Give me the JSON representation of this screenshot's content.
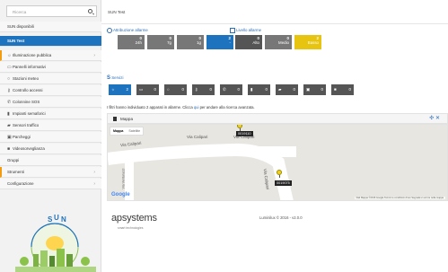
{
  "sidebar": {
    "search_placeholder": "Ricerca",
    "items": [
      {
        "label": "SUN disponibili",
        "icon": "",
        "chevron": false
      },
      {
        "label": "SUN Test",
        "icon": "",
        "chevron": false,
        "active": true
      },
      {
        "label": "Illuminazione pubblica",
        "icon": "lightbulb-icon",
        "chevron": true
      },
      {
        "label": "Pannelli informativi",
        "icon": "monitor-icon",
        "chevron": false
      },
      {
        "label": "Stazioni meteo",
        "icon": "cloud-icon",
        "chevron": false
      },
      {
        "label": "Controllo accessi",
        "icon": "key-icon",
        "chevron": false
      },
      {
        "label": "Colonnine SOS",
        "icon": "phone-icon",
        "chevron": false
      },
      {
        "label": "Impianti semaforici",
        "icon": "traffic-light-icon",
        "chevron": false
      },
      {
        "label": "Sensori traffico",
        "icon": "car-icon",
        "chevron": false
      },
      {
        "label": "Parcheggi",
        "icon": "parking-icon",
        "chevron": false
      },
      {
        "label": "Videosorveglianza",
        "icon": "camera-icon",
        "chevron": false
      },
      {
        "label": "Gruppi",
        "icon": "",
        "chevron": false
      },
      {
        "label": "Strumenti",
        "icon": "",
        "chevron": true
      },
      {
        "label": "Configurazione",
        "icon": "",
        "chevron": true
      }
    ]
  },
  "topbar": {
    "title": "SUN Test"
  },
  "attributes": {
    "label": "Attribuzione allarme",
    "tiles": [
      {
        "num": "0",
        "label": "24h",
        "color": "gray"
      },
      {
        "num": "0",
        "label": "7g",
        "color": "gray"
      },
      {
        "num": "0",
        "label": "1g",
        "color": "gray"
      },
      {
        "num": "2",
        "label": "-",
        "color": "blue"
      }
    ]
  },
  "alarm_level": {
    "label": "Livello allarme",
    "tiles": [
      {
        "num": "0",
        "label": "Alto",
        "color": "dark"
      },
      {
        "num": "0",
        "label": "Medio",
        "color": "gray"
      },
      {
        "num": "2",
        "label": "Basso",
        "color": "yellow"
      }
    ]
  },
  "services": {
    "label": "Servizi",
    "items": [
      {
        "icon": "lightbulb-icon",
        "count": "2",
        "blue": true
      },
      {
        "icon": "monitor-icon",
        "count": "0"
      },
      {
        "icon": "cloud-icon",
        "count": "0"
      },
      {
        "icon": "key-icon",
        "count": "0"
      },
      {
        "icon": "phone-icon",
        "count": "0"
      },
      {
        "icon": "traffic-light-icon",
        "count": "0"
      },
      {
        "icon": "car-icon",
        "count": "0"
      },
      {
        "icon": "parking-icon",
        "count": "0"
      },
      {
        "icon": "camera-icon",
        "count": "0"
      }
    ]
  },
  "alert_message": {
    "prefix": "I filtri hanno individuato 2 apparati in allarme. Clicca ",
    "link": "qui",
    "suffix": " per andare alla ricerca avanzata."
  },
  "map": {
    "title": "Mappa",
    "map_type_map": "Mappa",
    "map_type_satellite": "Satellite",
    "pins": [
      {
        "label": "0019110"
      },
      {
        "label": "0019075"
      }
    ],
    "streets": [
      "Via Calipari",
      "Via Calipari",
      "Via Calipari",
      "Via Calipari",
      "Via Venturuzzi"
    ],
    "footer": "Dati Mappa ©2016 Google    Termini e condizioni d'uso    Segnala un errore nella mappa",
    "google": "Google"
  },
  "footer": {
    "brand": "apsystems",
    "brand_sub": "smart technologies",
    "copyright": "Luminilux © 2016 - v2.0.0"
  }
}
